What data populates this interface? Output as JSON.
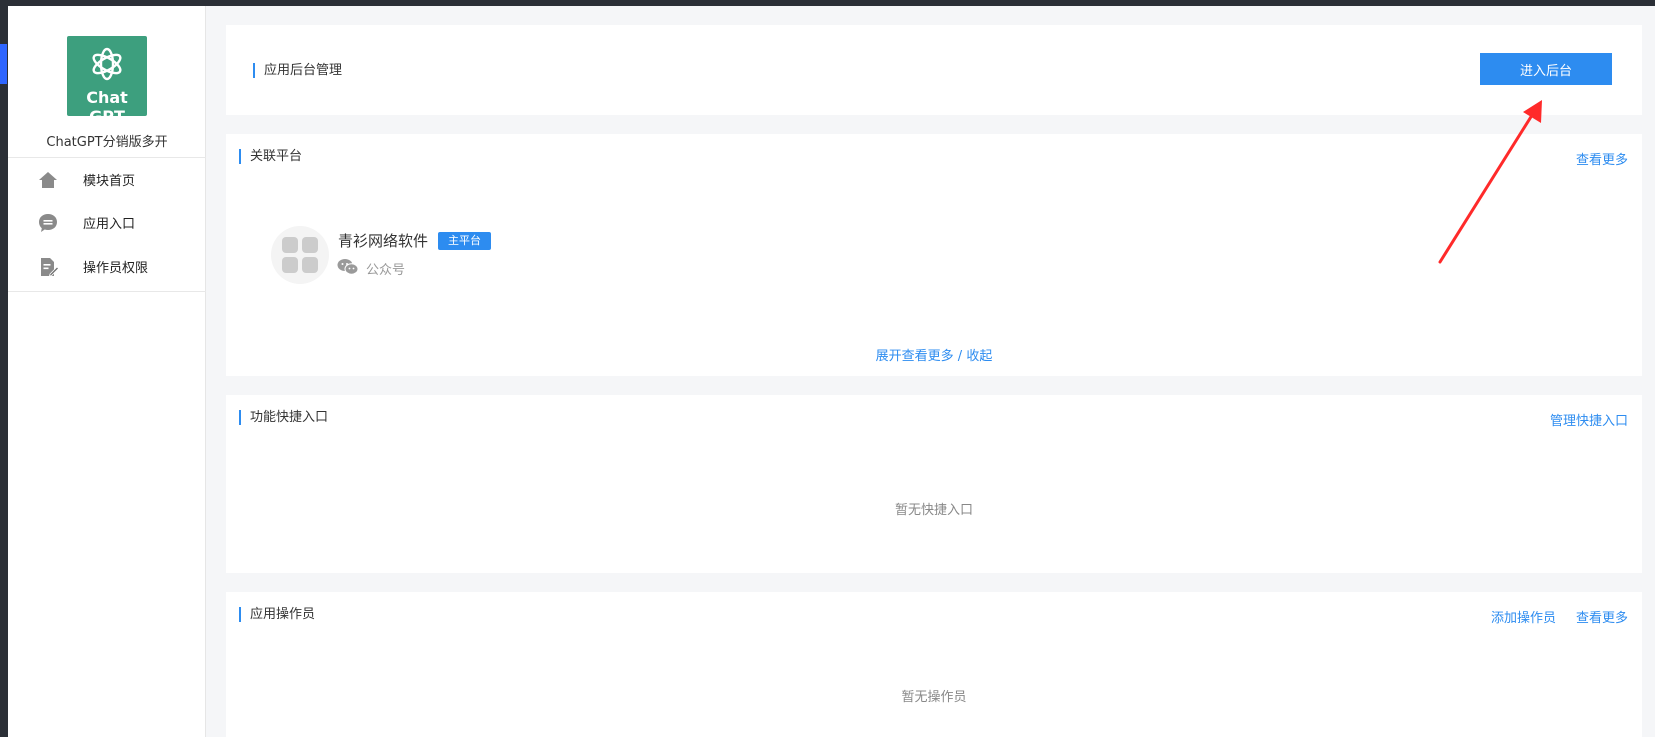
{
  "sidebar": {
    "logo_text": "Chat GPT",
    "app_name": "ChatGPT分销版多开",
    "items": [
      {
        "label": "模块首页",
        "icon": "home-icon"
      },
      {
        "label": "应用入口",
        "icon": "chat-bubble-icon"
      },
      {
        "label": "操作员权限",
        "icon": "document-edit-icon"
      }
    ]
  },
  "admin_card": {
    "title": "应用后台管理",
    "enter_button": "进入后台"
  },
  "platform_card": {
    "title": "关联平台",
    "more_link": "查看更多",
    "platform": {
      "name": "青衫网络软件",
      "badge": "主平台",
      "type": "公众号",
      "type_icon": "wechat-icon"
    },
    "expand_link": "展开查看更多 / 收起"
  },
  "shortcut_card": {
    "title": "功能快捷入口",
    "manage_link": "管理快捷入口",
    "empty_text": "暂无快捷入口"
  },
  "operator_card": {
    "title": "应用操作员",
    "add_link": "添加操作员",
    "more_link": "查看更多",
    "empty_text": "暂无操作员"
  },
  "colors": {
    "accent": "#2d8cf0",
    "logo_bg": "#3d9f7e",
    "annotation_arrow": "#ff2a2a"
  }
}
